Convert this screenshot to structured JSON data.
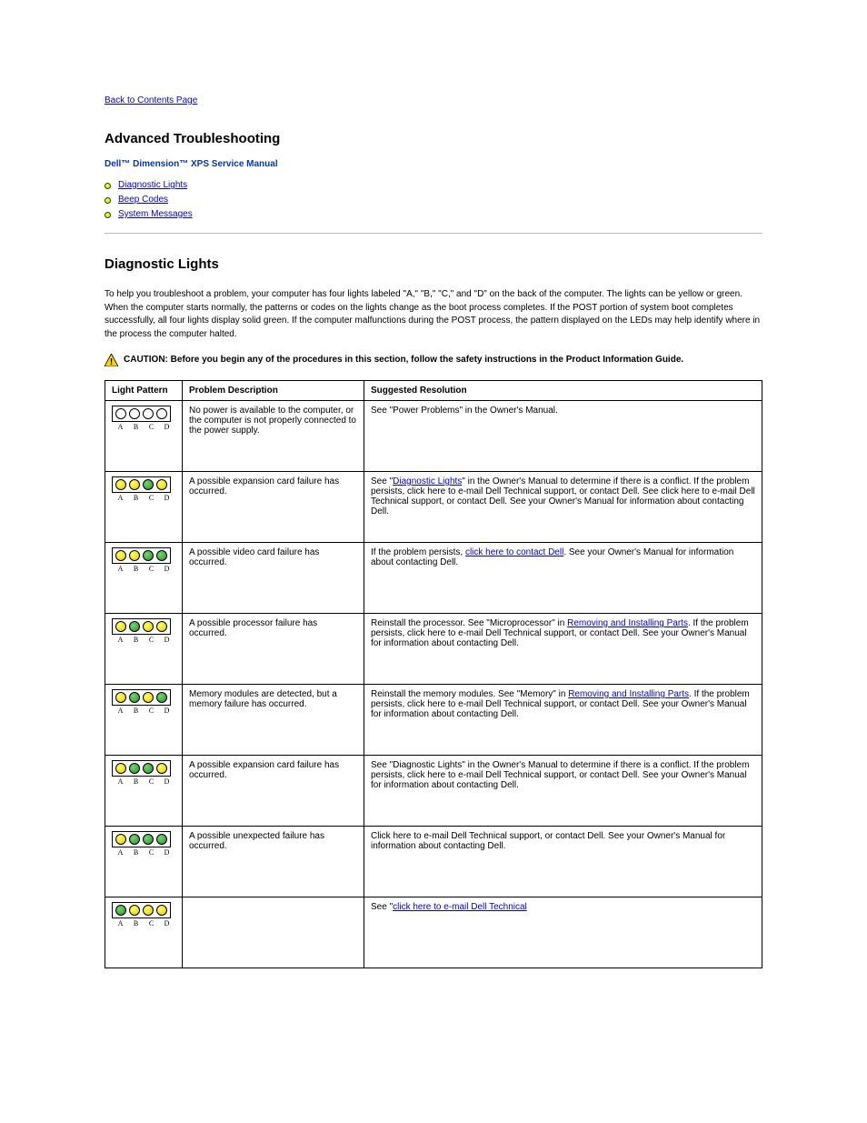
{
  "nav": {
    "back": "Back to Contents Page"
  },
  "series_title": "Advanced Troubleshooting",
  "manual_title": "Dell™ Dimension™ XPS Service Manual",
  "toc": {
    "item1": "Diagnostic Lights",
    "item2": "Beep Codes",
    "item3": "System Messages"
  },
  "section_heading": "Diagnostic Lights",
  "intro": "To help you troubleshoot a problem, your computer has four lights labeled \"A,\" \"B,\" \"C,\" and \"D\" on the back of the computer. The lights can be yellow or green. When the computer starts normally, the patterns or codes on the lights change as the boot process completes. If the POST portion of system boot completes successfully, all four lights display solid green. If the computer malfunctions during the POST process, the pattern displayed on the LEDs may help identify where in the process the computer halted.",
  "caution": "CAUTION: Before you begin any of the procedures in this section, follow the safety instructions in the Product Information Guide.",
  "labels": {
    "a": "A",
    "b": "B",
    "c": "C",
    "d": "D"
  },
  "table": {
    "h1": "Light Pattern",
    "h2": "Problem Description",
    "h3": "Suggested Resolution",
    "rows": [
      {
        "pattern": [
          "off",
          "off",
          "off",
          "off"
        ],
        "desc": "No power is available to the computer, or the computer is not properly connected to the power supply.",
        "res_pre": "See \"Power Problems\" in the Owner's Manual.",
        "link": "",
        "res_post": ""
      },
      {
        "pattern": [
          "yellow",
          "yellow",
          "green",
          "yellow"
        ],
        "desc": "A possible expansion card failure has occurred.",
        "res_pre": "See \"",
        "link": "Diagnostic Lights",
        "res_post": "\" in the Owner's Manual to determine if there is a conflict. If the problem persists, click here to e-mail Dell Technical support, or contact Dell. See click here to e-mail Dell Technical support, or contact Dell. See your Owner's Manual for information about contacting Dell."
      },
      {
        "pattern": [
          "yellow",
          "yellow",
          "green",
          "green"
        ],
        "desc": "A possible video card failure has occurred.",
        "res_pre": "If the problem persists, ",
        "link": "click here to contact Dell",
        "res_post": ". See your Owner's Manual for information about contacting Dell."
      },
      {
        "pattern": [
          "yellow",
          "green",
          "yellow",
          "yellow"
        ],
        "desc": "A possible processor failure has occurred.",
        "res_pre": "Reinstall the processor. See \"Microprocessor\" in ",
        "link": "Removing and Installing Parts",
        "res_post": ". If the problem persists, click here to e-mail Dell Technical support, or contact Dell. See your Owner's Manual for information about contacting Dell."
      },
      {
        "pattern": [
          "yellow",
          "green",
          "yellow",
          "green"
        ],
        "desc": "Memory modules are detected, but a memory failure has occurred.",
        "res_pre": "Reinstall the memory modules. See \"Memory\" in ",
        "link": "Removing and Installing Parts",
        "res_post": ". If the problem persists, click here to e-mail Dell Technical support, or contact Dell. See your Owner's Manual for information about contacting Dell."
      },
      {
        "pattern": [
          "yellow",
          "green",
          "green",
          "yellow"
        ],
        "desc": "A possible expansion card failure has occurred.",
        "res_pre": "See \"Diagnostic Lights\" in the Owner's Manual to determine if there is a conflict. If the problem persists, click here to e-mail Dell Technical support, or contact Dell. See your Owner's Manual for information about contacting Dell.",
        "link": "",
        "res_post": ""
      },
      {
        "pattern": [
          "yellow",
          "green",
          "green",
          "green"
        ],
        "desc": "A possible unexpected failure has occurred.",
        "res_pre": "Click here to e-mail Dell Technical support, or contact Dell. See your Owner's Manual for information about contacting Dell.",
        "link": "",
        "res_post": ""
      },
      {
        "pattern": [
          "green",
          "yellow",
          "yellow",
          "yellow"
        ],
        "desc": "",
        "res_pre": "See \"",
        "link": "click here to e-mail Dell Technical",
        "res_post": ""
      }
    ]
  }
}
